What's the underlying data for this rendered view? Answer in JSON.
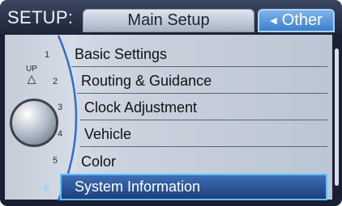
{
  "header": {
    "title": "SETUP:",
    "tabs": [
      {
        "label": "Main Setup",
        "selected": false
      },
      {
        "label": "Other",
        "selected": true
      }
    ]
  },
  "menu": {
    "items": [
      {
        "number": "1",
        "label": "Basic Settings"
      },
      {
        "number": "2",
        "label": "Routing & Guidance"
      },
      {
        "number": "3",
        "label": "Clock Adjustment"
      },
      {
        "number": "4",
        "label": "Vehicle"
      },
      {
        "number": "5",
        "label": "Color"
      },
      {
        "number": "6",
        "label": "System Information",
        "selected": true
      }
    ]
  },
  "dial": {
    "up_label": "UP"
  },
  "colors": {
    "accent": "#5fc2ff",
    "selected_bg": "#2a5597",
    "background": "#1a2033"
  }
}
